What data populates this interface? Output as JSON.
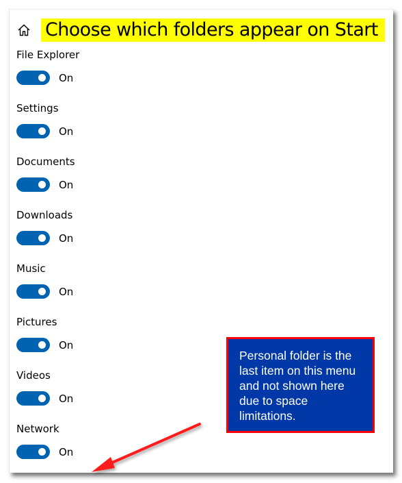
{
  "header": {
    "home_icon": "home-icon",
    "title": "Choose which folders appear on Start"
  },
  "folders": [
    {
      "label": "File Explorer",
      "state": "On",
      "enabled": true
    },
    {
      "label": "Settings",
      "state": "On",
      "enabled": true
    },
    {
      "label": "Documents",
      "state": "On",
      "enabled": true
    },
    {
      "label": "Downloads",
      "state": "On",
      "enabled": true
    },
    {
      "label": "Music",
      "state": "On",
      "enabled": true
    },
    {
      "label": "Pictures",
      "state": "On",
      "enabled": true
    },
    {
      "label": "Videos",
      "state": "On",
      "enabled": true
    },
    {
      "label": "Network",
      "state": "On",
      "enabled": true
    }
  ],
  "callout": {
    "text": "Personal folder is the last item on this menu and not shown here due to space limitations."
  },
  "colors": {
    "toggle_on": "#0063b1",
    "title_highlight": "#ffff00",
    "callout_bg": "#0038a8",
    "callout_border": "#ff0000",
    "arrow": "#ff0000"
  }
}
